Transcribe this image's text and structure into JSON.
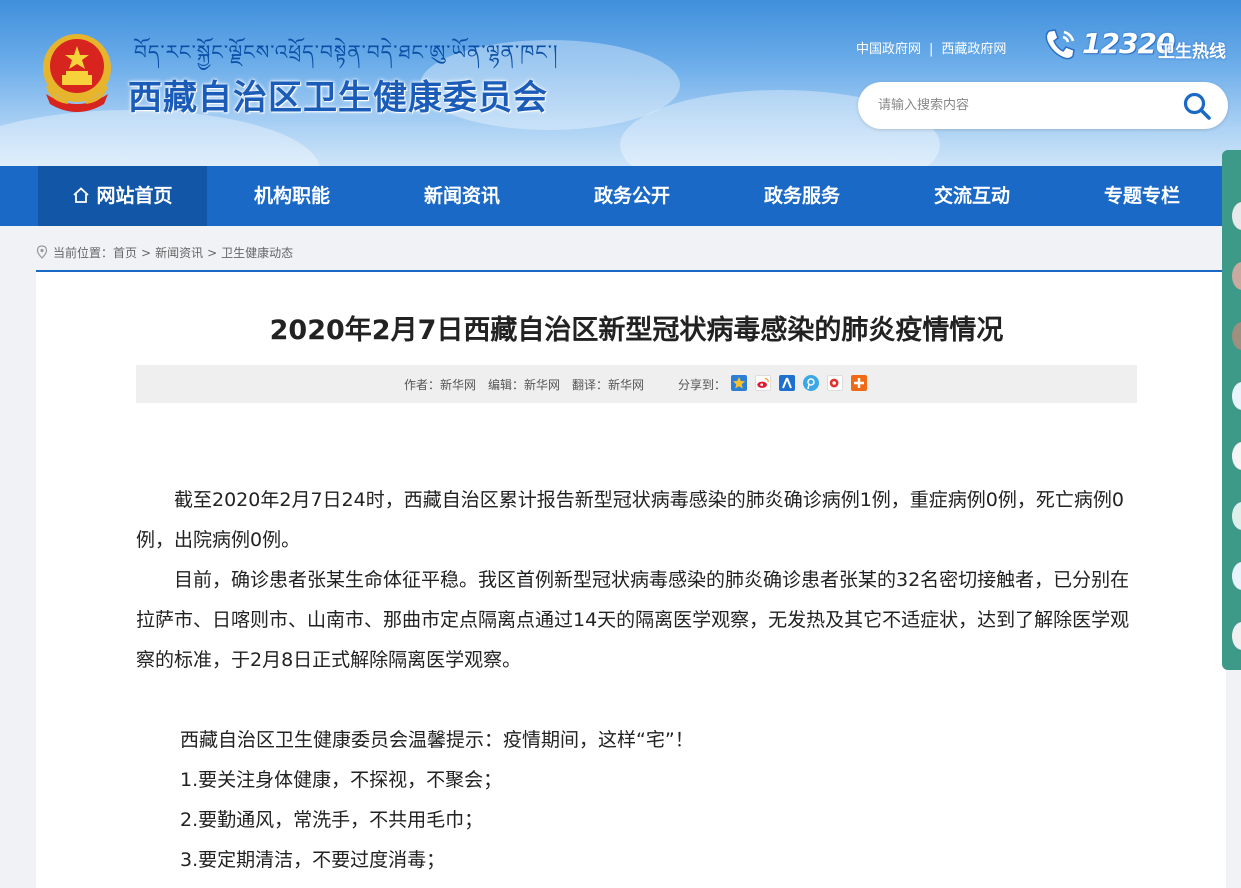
{
  "header": {
    "tibetan_title": "བོད་རང་སྐྱོང་ལྗོངས་འཕྲོད་བསྟེན་བདེ་ཐང་ཨུ་ཡོན་ལྷན་ཁང་།",
    "title": "西藏自治区卫生健康委员会",
    "links": [
      "中国政府网",
      "西藏政府网"
    ],
    "link_separator": "|",
    "hotline_number": "12320",
    "hotline_label": "卫生热线",
    "search_placeholder": "请输入搜索内容",
    "colors": {
      "header_top": "#3f8fdc",
      "title": "#1a5cb8"
    }
  },
  "nav": {
    "items": [
      "网站首页",
      "机构职能",
      "新闻资讯",
      "政务公开",
      "政务服务",
      "交流互动",
      "专题专栏"
    ],
    "active_index": 0,
    "colors": {
      "bar": "#1a69c6",
      "active": "#1256a8"
    }
  },
  "breadcrumb": {
    "prefix": "当前位置：",
    "items": [
      "首页",
      "新闻资讯",
      "卫生健康动态"
    ],
    "separator": ">"
  },
  "article": {
    "title": "2020年2月7日西藏自治区新型冠状病毒感染的肺炎疫情情况",
    "author": "作者：新华网",
    "editor": "编辑：新华网",
    "translator": "翻译：新华网",
    "share_label": "分享到：",
    "share_icons": [
      "qzone-icon",
      "weibo-icon",
      "renren-icon",
      "tencent-weibo-icon",
      "baidu-icon",
      "more-share-icon"
    ],
    "paragraphs": [
      "截至2020年2月7日24时，西藏自治区累计报告新型冠状病毒感染的肺炎确诊病例1例，重症病例0例，死亡病例0例，出院病例0例。",
      "目前，确诊患者张某生命体征平稳。我区首例新型冠状病毒感染的肺炎确诊患者张某的32名密切接触者，已分别在拉萨市、日喀则市、山南市、那曲市定点隔离点通过14天的隔离医学观察，无发热及其它不适症状，达到了解除医学观察的标准，于2月8日正式解除隔离医学观察。"
    ],
    "tips": [
      "西藏自治区卫生健康委员会温馨提示：疫情期间，这样“宅”！",
      "1.要关注身体健康，不探视，不聚会；",
      "2.要勤通风，常洗手，不共用毛巾；",
      "3.要定期清洁，不要过度消毒；"
    ]
  }
}
